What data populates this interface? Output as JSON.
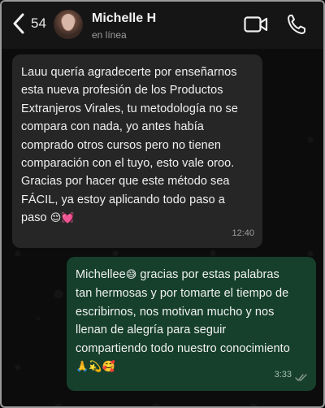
{
  "header": {
    "back_count": "54",
    "contact_name": "Michelle H",
    "contact_status": "en línea"
  },
  "messages": [
    {
      "direction": "incoming",
      "text": "Lauu quería agradecerte por enseñarnos\nesta nueva profesión de los Productos\nExtranjeros Virales, tu metodología no se\ncompara con nada, yo antes había\ncomprado otros cursos pero no tienen\ncomparación con el tuyo, esto vale oroo.\nGracias por hacer que este método sea\nFÁCIL, ya estoy aplicando todo paso a\npaso ",
      "emoji": "😌💓",
      "time": "12:40"
    },
    {
      "direction": "outgoing",
      "text_start": "Michellee",
      "emoji_start": "😅",
      "text": " gracias por estas palabras\ntan hermosas y por tomarte el tiempo de\nescribirnos, nos motivan mucho y nos\nllenan de alegría para seguir\ncompartiendo todo nuestro conocimiento\n",
      "emoji_end": "🙏💫🥰",
      "time": "3:33",
      "status": "read"
    }
  ],
  "colors": {
    "incoming_bubble": "#262626",
    "outgoing_bubble": "#16402c",
    "header": "#151515",
    "read_ticks": "#8a9a90"
  },
  "icons": [
    "back-chevron-icon",
    "video-call-icon",
    "phone-icon",
    "double-check-icon"
  ]
}
